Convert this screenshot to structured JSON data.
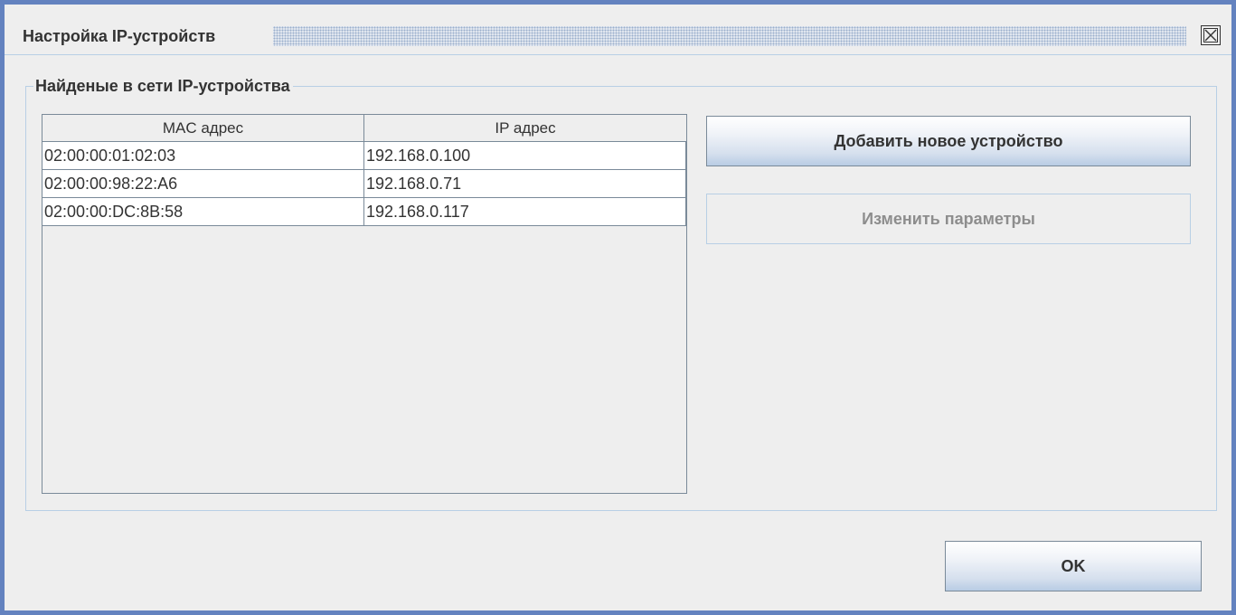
{
  "window": {
    "title": "Настройка IP-устройств",
    "close_icon": "close-icon"
  },
  "group": {
    "title": "Найденые в сети IP-устройства"
  },
  "table": {
    "columns": [
      "MAC адрес",
      "IP адрес"
    ],
    "rows": [
      [
        "02:00:00:01:02:03",
        "192.168.0.100"
      ],
      [
        "02:00:00:98:22:A6",
        "192.168.0.71"
      ],
      [
        "02:00:00:DC:8B:58",
        "192.168.0.117"
      ]
    ]
  },
  "buttons": {
    "add_label": "Добавить новое устройство",
    "edit_label": "Изменить параметры",
    "ok_label": "OK"
  },
  "colors": {
    "frame": "#6382bf",
    "background": "#eeeeee",
    "border_light": "#b8cfe5",
    "disabled_text": "#8d8d8d"
  }
}
